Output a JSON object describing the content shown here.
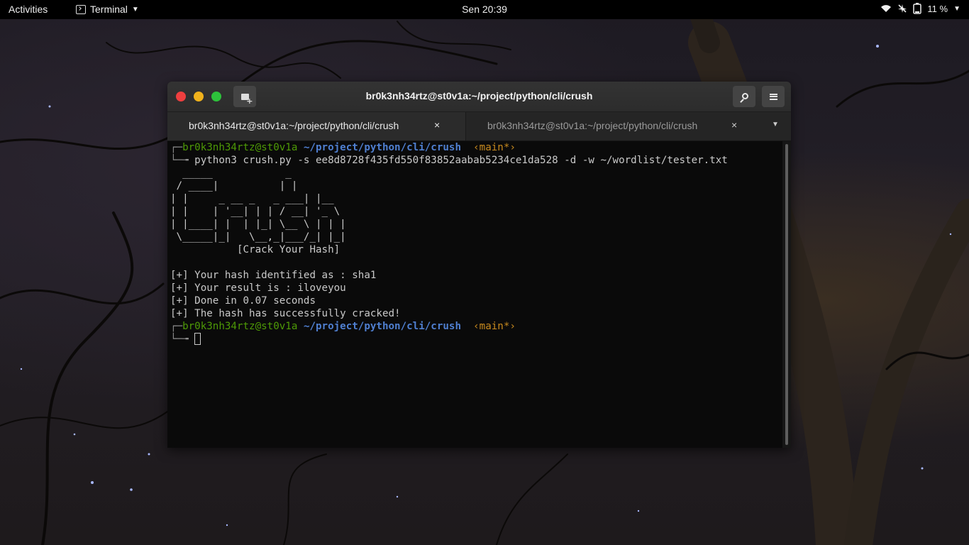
{
  "topbar": {
    "activities": "Activities",
    "app_name": "Terminal",
    "clock": "Sen 20:39",
    "battery_percent": "11 %",
    "icons": [
      "wifi-icon",
      "airplane-mode-icon",
      "battery-icon",
      "power-menu-caret"
    ]
  },
  "window": {
    "title": "br0k3nh34rtz@st0v1a:~/project/python/cli/crush",
    "tabs": [
      {
        "label": "br0k3nh34rtz@st0v1a:~/project/python/cli/crush",
        "active": true
      },
      {
        "label": "br0k3nh34rtz@st0v1a:~/project/python/cli/crush",
        "active": false
      }
    ],
    "tab_close_glyph": "×"
  },
  "terminal": {
    "prompt_user": "br0k3nh34rtz",
    "prompt_at": "@",
    "prompt_host": "st0v1a",
    "prompt_path": "~/project/python/cli/crush",
    "prompt_branch": "‹main*›",
    "command": "python3 crush.py -s ee8d8728f435fd550f83852aabab5234ce1da528 -d -w ~/wordlist/tester.txt",
    "banner": [
      "  _____            _",
      " / ____|          | |",
      "| |     _ __ _   _ ___| |__",
      "| |    | '__| | | / __| '_ \\",
      "| |____| |  | |_| \\__ \\ | | |",
      " \\_____|_|   \\__,_|___/_| |_|"
    ],
    "tagline": "           [Crack Your Hash]",
    "output": [
      "[+] Your hash identified as : sha1",
      "[+] Your result is : iloveyou",
      "[+] Done in 0.07 seconds",
      "[+] The hash has successfully cracked!"
    ]
  },
  "colors": {
    "prompt_green": "#4e9a06",
    "path_blue": "#4f7fd0",
    "branch_orange": "#c88a1e",
    "close_red": "#ee3f3f",
    "min_yellow": "#f0b21c",
    "max_green": "#2dc23b"
  }
}
